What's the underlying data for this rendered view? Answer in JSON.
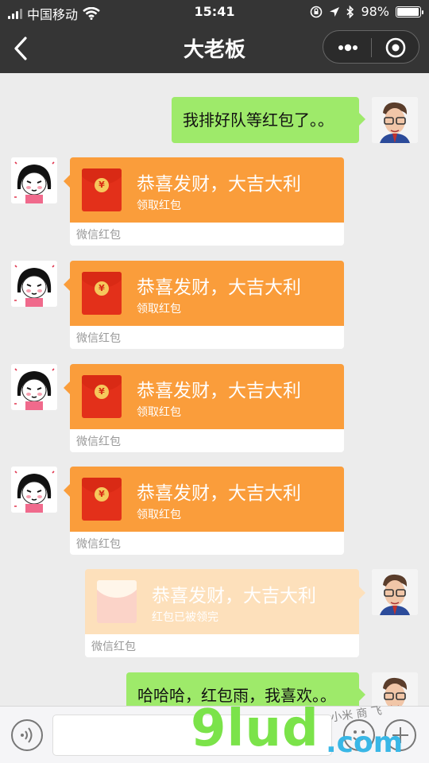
{
  "status_bar": {
    "carrier": "中国移动",
    "time": "15:41",
    "battery_percent": "98%",
    "battery_level": 0.98,
    "icons": [
      "signal-icon",
      "wifi-icon",
      "lock-rotation-icon",
      "location-icon",
      "bluetooth-icon",
      "battery-icon"
    ]
  },
  "nav": {
    "title": "大老板",
    "back_icon": "chevron-left-icon",
    "more_icon": "more-dots-icon",
    "close_icon": "target-icon"
  },
  "messages": [
    {
      "type": "text",
      "side": "right",
      "text": "我排好队等红包了。。"
    },
    {
      "type": "redpacket",
      "side": "left",
      "title": "恭喜发财，大吉大利",
      "status": "领取红包",
      "footer": "微信红包"
    },
    {
      "type": "redpacket",
      "side": "left",
      "title": "恭喜发财，大吉大利",
      "status": "领取红包",
      "footer": "微信红包"
    },
    {
      "type": "redpacket",
      "side": "left",
      "title": "恭喜发财，大吉大利",
      "status": "领取红包",
      "footer": "微信红包"
    },
    {
      "type": "redpacket",
      "side": "left",
      "title": "恭喜发财，大吉大利",
      "status": "领取红包",
      "footer": "微信红包"
    },
    {
      "type": "redpacket",
      "side": "right",
      "title": "恭喜发财，大吉大利",
      "status": "红包已被领完",
      "footer": "微信红包"
    },
    {
      "type": "text",
      "side": "right",
      "text": "哈哈哈，红包雨，我喜欢。。"
    }
  ],
  "envelope_symbol": "¥",
  "input_bar": {
    "placeholder": "",
    "icons": [
      "voice-icon",
      "emoji-icon",
      "plus-icon"
    ]
  },
  "watermark": {
    "brand": "9lud",
    "domain": ".com",
    "script": "小米 商 飞"
  },
  "colors": {
    "header_bg": "#353535",
    "chat_bg": "#ececec",
    "bubble_green": "#9eea6a",
    "redpacket_orange": "#fa9d3b",
    "redpacket_opened": "#fde0bb"
  }
}
